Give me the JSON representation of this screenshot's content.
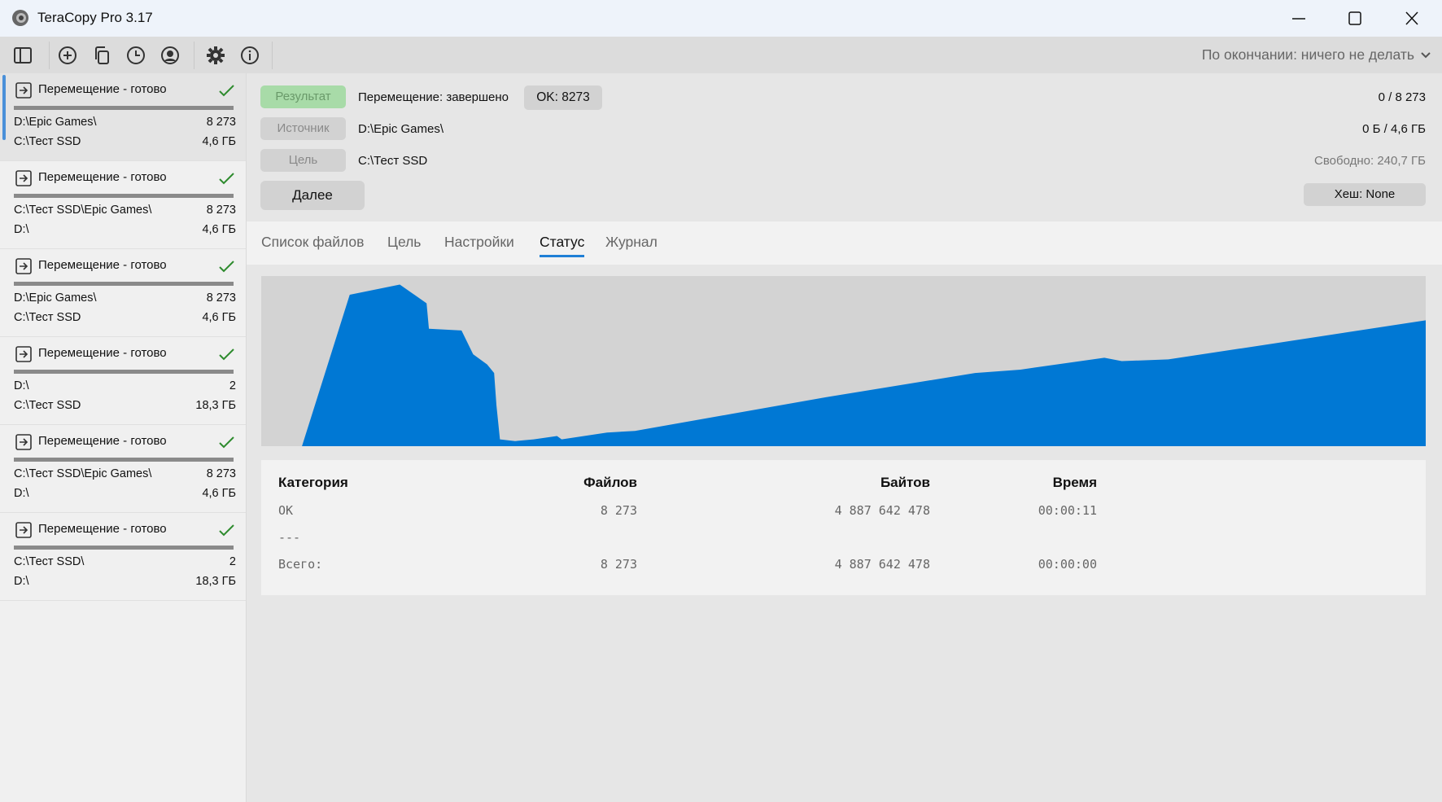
{
  "window": {
    "title": "TeraCopy Pro 3.17"
  },
  "toolbar": {
    "after_completion": "По окончании: ничего не делать"
  },
  "sidebar": {
    "items": [
      {
        "title": "Перемещение - готово",
        "source": "D:\\Epic Games\\",
        "files": "8 273",
        "target": "C:\\Тест SSD",
        "size": "4,6 ГБ"
      },
      {
        "title": "Перемещение - готово",
        "source": "C:\\Тест SSD\\Epic Games\\",
        "files": "8 273",
        "target": "D:\\",
        "size": "4,6 ГБ"
      },
      {
        "title": "Перемещение - готово",
        "source": "D:\\Epic Games\\",
        "files": "8 273",
        "target": "C:\\Тест SSD",
        "size": "4,6 ГБ"
      },
      {
        "title": "Перемещение - готово",
        "source": "D:\\",
        "files": "2",
        "target": "C:\\Тест SSD",
        "size": "18,3 ГБ"
      },
      {
        "title": "Перемещение - готово",
        "source": "C:\\Тест SSD\\Epic Games\\",
        "files": "8 273",
        "target": "D:\\",
        "size": "4,6 ГБ"
      },
      {
        "title": "Перемещение - готово",
        "source": "C:\\Тест SSD\\",
        "files": "2",
        "target": "D:\\",
        "size": "18,3 ГБ"
      }
    ]
  },
  "summary": {
    "result_label": "Результат",
    "result_value": "Перемещение: завершено",
    "ok_badge": "OK: 8273",
    "files_progress": "0 / 8 273",
    "source_label": "Источник",
    "source_value": "D:\\Epic Games\\",
    "bytes_progress": "0 Б / 4,6 ГБ",
    "target_label": "Цель",
    "target_value": "C:\\Тест SSD",
    "free_space": "Свободно: 240,7 ГБ",
    "next_button": "Далее",
    "hash_button": "Хеш: None"
  },
  "tabs": [
    "Список файлов",
    "Цель",
    "Настройки",
    "Статус",
    "Журнал"
  ],
  "colors": {
    "accent": "#0078d4",
    "result_green": "#a8dba8"
  },
  "chart_data": {
    "type": "area",
    "xlabel": "",
    "ylabel": "",
    "description_units": "percent of time vs percent of max speed",
    "x": [
      3.5,
      7.6,
      11.9,
      14.2,
      14.4,
      17.2,
      18.2,
      19.4,
      20,
      20.2,
      20.5,
      21.8,
      23.4,
      25.4,
      25.8,
      29.7,
      32.1,
      48.7,
      61.3,
      65.2,
      72.4,
      73.9,
      77.9,
      86.6,
      100
    ],
    "y": [
      0,
      89,
      95,
      84,
      69,
      68,
      54,
      48,
      43,
      24,
      4,
      3,
      4,
      6,
      4,
      8,
      9,
      29,
      43,
      45,
      52,
      50,
      51,
      60,
      74
    ]
  },
  "stats": {
    "headers": [
      "Категория",
      "Файлов",
      "Байтов",
      "Время"
    ],
    "rows": [
      [
        "OK",
        "8 273",
        "4 887 642 478",
        "00:00:11"
      ],
      [
        "---",
        "",
        "",
        ""
      ],
      [
        "Всего:",
        "8 273",
        "4 887 642 478",
        "00:00:00"
      ]
    ]
  }
}
